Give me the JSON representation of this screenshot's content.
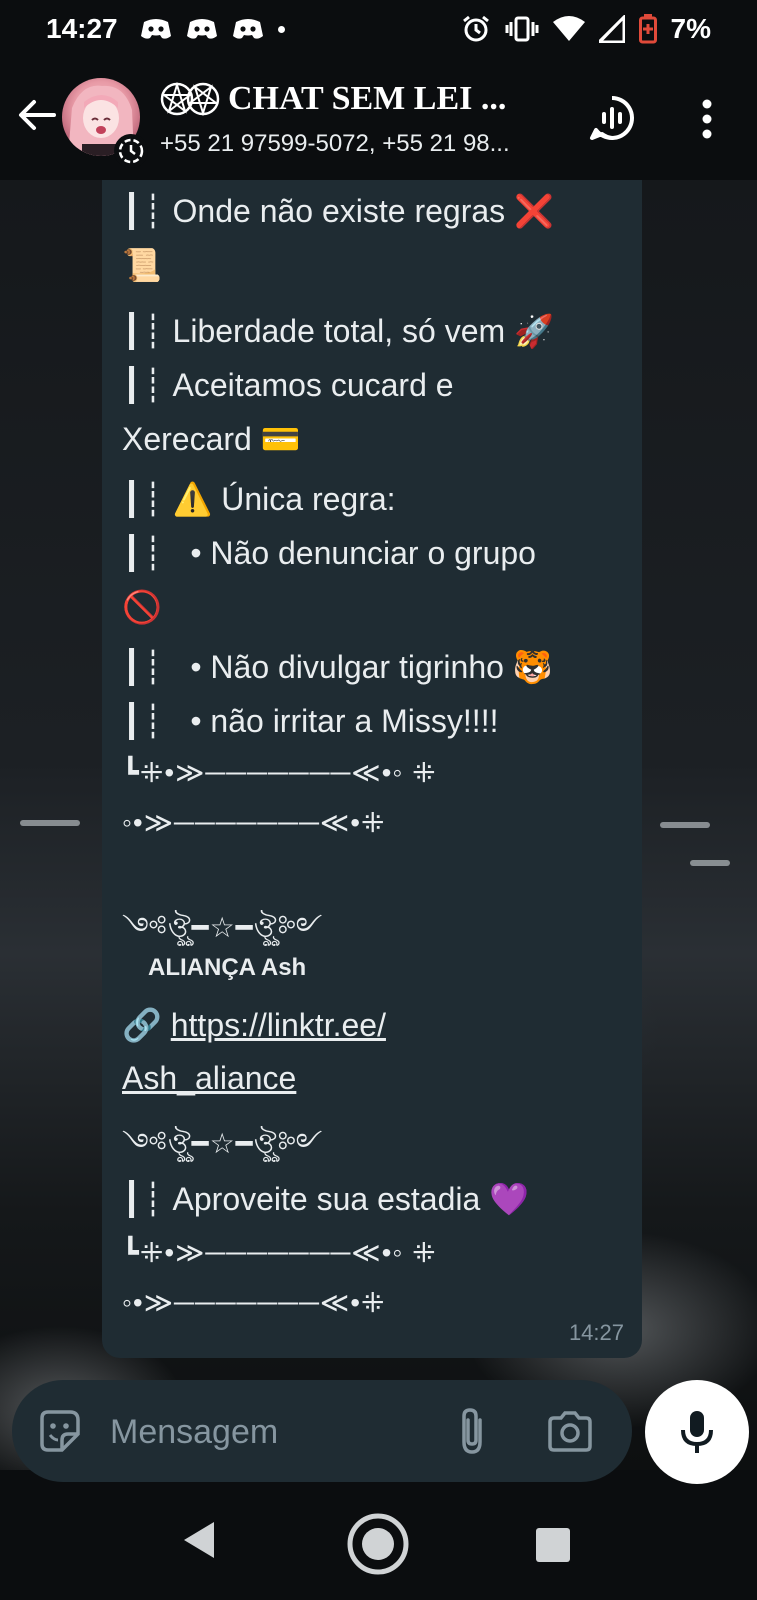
{
  "status_bar": {
    "time": "14:27",
    "battery": "7%"
  },
  "header": {
    "title": "CHAT SEM LEI ...",
    "subtitle": "+55 21 97599-5072, +55 21 98..."
  },
  "message": {
    "lines": [
      {
        "bar": "┃┊",
        "text": "Onde não existe regras ❌"
      },
      {
        "bar": "",
        "text": "📜"
      },
      {
        "bar": "┃┊",
        "text": "Liberdade total, só vem 🚀"
      },
      {
        "bar": "┃┊",
        "text": "Aceitamos cucard e"
      },
      {
        "bar": "",
        "text": "Xerecard 💳"
      },
      {
        "bar": "┃┊",
        "text": "⚠️ Única regra:"
      },
      {
        "bar": "┃┊",
        "text": "  • Não denunciar o grupo"
      },
      {
        "bar": "",
        "text": "🚫"
      },
      {
        "bar": "┃┊",
        "text": "  • Não divulgar tigrinho 🐯"
      },
      {
        "bar": "┃┊",
        "text": "  • não irritar a Missy!!!!"
      }
    ],
    "deco_1": "┗⁜•≫───────≪•◦ ⁜",
    "deco_2": "◦•≫───────≪•⁜",
    "deco_3": "༺ঔৣ━☆━ঔৣ༻",
    "alliance_label": "ALIANÇA Ash",
    "link_icon": "🔗",
    "link_part1": "https://linktr.ee/",
    "link_part2": "Ash_aliance",
    "deco_4": "༺ঔৣ━☆━ঔৣ༻",
    "enjoy_bar": "┃┊",
    "enjoy_text": "Aproveite sua estadia 💜",
    "deco_5": "┗⁜•≫───────≪•◦ ⁜",
    "deco_6": "◦•≫───────≪•⁜",
    "time": "14:27"
  },
  "input": {
    "placeholder": "Mensagem"
  },
  "icons": {
    "back": "arrow-left-icon",
    "voice_chat": "voice-chat-icon",
    "menu": "more-vertical-icon",
    "emoji": "sticker-icon",
    "attach": "paperclip-icon",
    "camera": "camera-icon",
    "mic": "microphone-icon"
  },
  "colors": {
    "bubble": "#1f2c33",
    "header": "#0b0d0f",
    "text": "#e9edef",
    "muted": "#8696a0",
    "battery": "#e04a3a"
  }
}
